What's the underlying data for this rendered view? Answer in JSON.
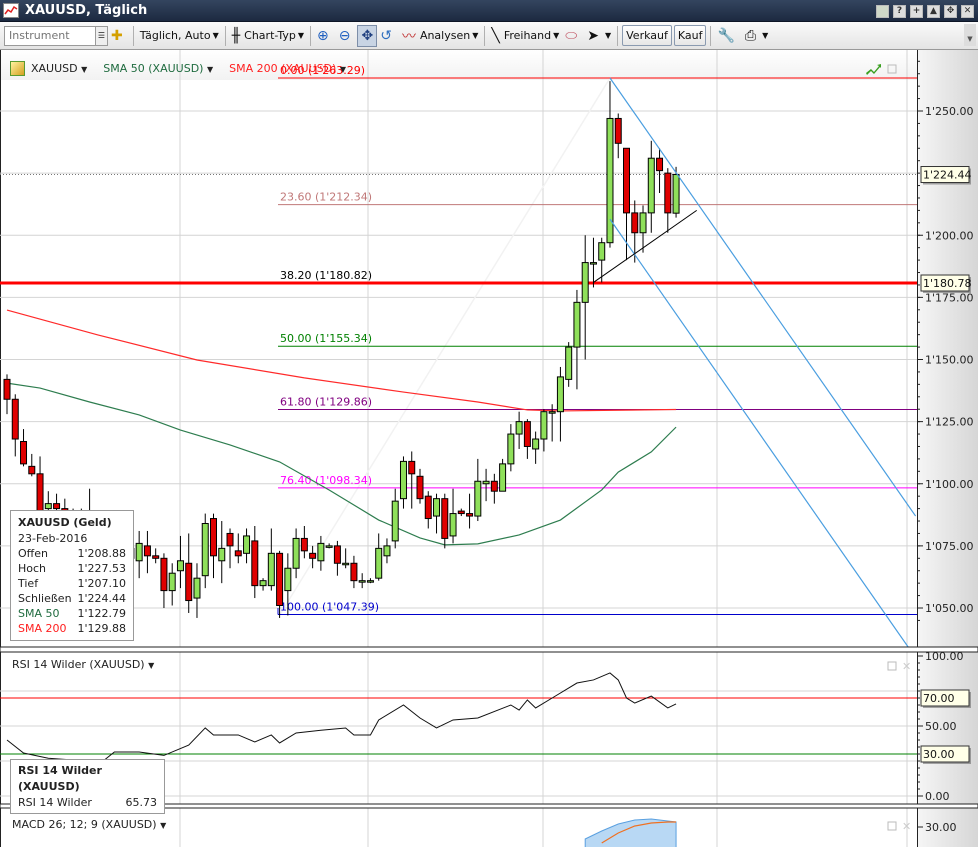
{
  "window": {
    "title": "XAUUSD, Täglich",
    "buttons": [
      "restore",
      "help",
      "new",
      "minimize",
      "maximize",
      "close"
    ]
  },
  "toolbar": {
    "instrument_placeholder": "Instrument",
    "period": "Täglich,  Auto",
    "chart_type": "Chart-Typ",
    "analysen": "Analysen",
    "freihand": "Freihand",
    "verkauf": "Verkauf",
    "kauf": "Kauf"
  },
  "legend": {
    "instrument": "XAUUSD",
    "sma50": "SMA 50 (XAUUSD)",
    "sma200": "SMA 200 (XAUUSD)",
    "caret": "▼"
  },
  "tooltip": {
    "title": "XAUUSD (Geld)",
    "date": "23-Feb-2016",
    "rows": [
      {
        "label": "Offen",
        "value": "1'208.88"
      },
      {
        "label": "Hoch",
        "value": "1'227.53"
      },
      {
        "label": "Tief",
        "value": "1'207.10"
      },
      {
        "label": "Schließen",
        "value": "1'224.44"
      },
      {
        "label": "SMA 50",
        "value": "1'122.79"
      },
      {
        "label": "SMA 200",
        "value": "1'129.88"
      }
    ]
  },
  "rsi_panel": {
    "legend": "RSI 14 Wilder (XAUUSD)",
    "tooltip_title": "RSI 14 Wilder (XAUUSD)",
    "tooltip_label": "RSI 14 Wilder",
    "tooltip_value": "65.73"
  },
  "macd_panel": {
    "legend": "MACD 26; 12; 9 (XAUUSD)"
  },
  "colors": {
    "up": "#8fe05a",
    "down": "#e00000",
    "sma50": "#2e7d4f",
    "sma200": "#ff2a2a",
    "channel": "#4a9ee0"
  },
  "chart_data": {
    "type": "candlestick",
    "symbol": "XAUUSD",
    "ohlc": [
      [
        1142,
        1144,
        1128,
        1134
      ],
      [
        1134,
        1136,
        1111,
        1118
      ],
      [
        1117,
        1122,
        1107,
        1108
      ],
      [
        1107,
        1112,
        1103,
        1104
      ],
      [
        1104,
        1111,
        1083,
        1087
      ],
      [
        1090,
        1097,
        1080,
        1092
      ],
      [
        1092,
        1096,
        1080,
        1090
      ],
      [
        1090,
        1094,
        1072,
        1080
      ],
      [
        1080,
        1090,
        1070,
        1086
      ],
      [
        1086,
        1090,
        1074,
        1082
      ],
      [
        1082,
        1098,
        1062,
        1066
      ],
      [
        1066,
        1080,
        1060,
        1069
      ],
      [
        1070,
        1076,
        1055,
        1063
      ],
      [
        1064,
        1085,
        1060,
        1078
      ],
      [
        1078,
        1085,
        1065,
        1074
      ],
      [
        1074,
        1080,
        1060,
        1070
      ],
      [
        1069,
        1081,
        1062,
        1076
      ],
      [
        1075,
        1081,
        1064,
        1071
      ],
      [
        1071,
        1074,
        1068,
        1070
      ],
      [
        1070,
        1072,
        1050,
        1057
      ],
      [
        1057,
        1068,
        1051,
        1064
      ],
      [
        1065,
        1079,
        1058,
        1069
      ],
      [
        1068,
        1080,
        1048,
        1053
      ],
      [
        1054,
        1068,
        1046,
        1062
      ],
      [
        1063,
        1088,
        1058,
        1084
      ],
      [
        1086,
        1088,
        1062,
        1071
      ],
      [
        1069,
        1085,
        1060,
        1074
      ],
      [
        1080,
        1082,
        1066,
        1075
      ],
      [
        1073,
        1080,
        1068,
        1071
      ],
      [
        1072,
        1082,
        1068,
        1079
      ],
      [
        1077,
        1083,
        1054,
        1059
      ],
      [
        1059,
        1062,
        1057,
        1061
      ],
      [
        1059,
        1082,
        1057,
        1072
      ],
      [
        1072,
        1073,
        1046,
        1051
      ],
      [
        1057,
        1072,
        1047,
        1066
      ],
      [
        1066,
        1082,
        1062,
        1078
      ],
      [
        1078,
        1083,
        1070,
        1073
      ],
      [
        1072,
        1075,
        1066,
        1070
      ],
      [
        1069,
        1079,
        1065,
        1076
      ],
      [
        1075,
        1076,
        1074,
        1075
      ],
      [
        1075,
        1077,
        1063,
        1068
      ],
      [
        1068,
        1074,
        1066,
        1068
      ],
      [
        1068,
        1071,
        1058,
        1061
      ],
      [
        1061,
        1064,
        1058,
        1061
      ],
      [
        1061,
        1062,
        1060,
        1061
      ],
      [
        1062,
        1080,
        1061,
        1074
      ],
      [
        1071,
        1078,
        1068,
        1075
      ],
      [
        1077,
        1098,
        1074,
        1093
      ],
      [
        1094,
        1111,
        1090,
        1109
      ],
      [
        1109,
        1113,
        1090,
        1104
      ],
      [
        1103,
        1106,
        1092,
        1094
      ],
      [
        1095,
        1097,
        1082,
        1086
      ],
      [
        1087,
        1096,
        1080,
        1094
      ],
      [
        1094,
        1096,
        1074,
        1078
      ],
      [
        1079,
        1098,
        1076,
        1088
      ],
      [
        1089,
        1090,
        1087,
        1088
      ],
      [
        1088,
        1096,
        1082,
        1087
      ],
      [
        1087,
        1110,
        1085,
        1101
      ],
      [
        1100,
        1106,
        1093,
        1101
      ],
      [
        1101,
        1104,
        1092,
        1097
      ],
      [
        1097,
        1110,
        1097,
        1108
      ],
      [
        1108,
        1124,
        1105,
        1120
      ],
      [
        1120,
        1129,
        1114,
        1125
      ],
      [
        1125,
        1126,
        1110,
        1115
      ],
      [
        1114,
        1121,
        1108,
        1118
      ],
      [
        1118,
        1130,
        1113,
        1129
      ],
      [
        1129,
        1132,
        1117,
        1129
      ],
      [
        1129,
        1147,
        1117,
        1143
      ],
      [
        1142,
        1157,
        1139,
        1155
      ],
      [
        1155,
        1178,
        1138,
        1173
      ],
      [
        1173,
        1200,
        1150,
        1189
      ],
      [
        1189,
        1199,
        1179,
        1189
      ],
      [
        1190,
        1199,
        1181,
        1197
      ],
      [
        1197,
        1262,
        1195,
        1247
      ],
      [
        1247,
        1249,
        1231,
        1237
      ],
      [
        1235,
        1235,
        1190,
        1209
      ],
      [
        1209,
        1214,
        1189,
        1201
      ],
      [
        1201,
        1212,
        1193,
        1209
      ],
      [
        1209,
        1238,
        1201,
        1231
      ],
      [
        1231,
        1235,
        1217,
        1226
      ],
      [
        1225,
        1227,
        1201,
        1209
      ],
      [
        1208.88,
        1227.53,
        1207.1,
        1224.44
      ]
    ],
    "sma50": [
      [
        0,
        1140.5
      ],
      [
        4,
        1138.5
      ],
      [
        10,
        1132.9
      ],
      [
        16,
        1127.7
      ],
      [
        21,
        1121.6
      ],
      [
        27,
        1115.6
      ],
      [
        33,
        1108.8
      ],
      [
        39,
        1097.5
      ],
      [
        45,
        1085.4
      ],
      [
        50,
        1078.2
      ],
      [
        53,
        1075.4
      ],
      [
        57,
        1075.8
      ],
      [
        62,
        1079.4
      ],
      [
        67,
        1085.4
      ],
      [
        72,
        1097.5
      ],
      [
        74,
        1104.7
      ],
      [
        78,
        1112.8
      ],
      [
        81,
        1122.79
      ]
    ],
    "sma200": [
      [
        0,
        1169.9
      ],
      [
        11,
        1159.9
      ],
      [
        23,
        1149.8
      ],
      [
        36,
        1142.6
      ],
      [
        48,
        1136.9
      ],
      [
        57,
        1132.9
      ],
      [
        63,
        1129.7
      ],
      [
        67,
        1129.3
      ],
      [
        81,
        1129.88
      ]
    ],
    "y_axis": {
      "ticks": [
        "1'250.00",
        "1'200.00",
        "1'175.00",
        "1'150.00",
        "1'125.00",
        "1'100.00",
        "1'075.00",
        "1'050.00"
      ],
      "tick_values": [
        1250,
        1200,
        1175,
        1150,
        1125,
        1100,
        1075,
        1050
      ],
      "range": [
        1040,
        1275
      ]
    },
    "last_price": {
      "value": 1224.44,
      "label": "1'224.44"
    },
    "hline": {
      "value": 1180.78,
      "label": "1'180.78"
    },
    "fibonacci": [
      {
        "label": "0.00 (1'263.29)",
        "value": 1263.29,
        "color": "#ff0000"
      },
      {
        "label": "23.60 (1'212.34)",
        "value": 1212.34,
        "color": "#c07878"
      },
      {
        "label": "38.20 (1'180.82)",
        "value": 1180.82,
        "color": "#000000"
      },
      {
        "label": "50.00 (1'155.34)",
        "value": 1155.34,
        "color": "#008000"
      },
      {
        "label": "61.80 (1'129.86)",
        "value": 1129.86,
        "color": "#800080"
      },
      {
        "label": "76.40 (1'098.34)",
        "value": 1098.34,
        "color": "#ff00ff"
      },
      {
        "label": "100.00 (1'047.39)",
        "value": 1047.39,
        "color": "#0000cc"
      }
    ],
    "channel": {
      "upper": [
        [
          73,
          1263.29
        ],
        [
          110,
          1087
        ]
      ],
      "lower": [
        [
          73,
          1206.5
        ],
        [
          110,
          1030
        ]
      ]
    },
    "support_trend": [
      [
        71,
        1181
      ],
      [
        83.5,
        1210
      ]
    ],
    "rsi": {
      "values": [
        [
          0,
          40
        ],
        [
          2,
          30.7
        ],
        [
          5,
          27
        ],
        [
          8,
          25.7
        ],
        [
          11,
          22
        ],
        [
          13,
          31.4
        ],
        [
          16,
          31.4
        ],
        [
          19,
          29
        ],
        [
          22,
          36.4
        ],
        [
          24,
          48.6
        ],
        [
          25,
          43.6
        ],
        [
          28,
          43.6
        ],
        [
          30,
          38.6
        ],
        [
          32,
          43.6
        ],
        [
          33,
          37.9
        ],
        [
          35,
          45
        ],
        [
          38,
          47
        ],
        [
          41,
          48.6
        ],
        [
          42,
          43.6
        ],
        [
          44,
          43.6
        ],
        [
          45,
          54.3
        ],
        [
          48,
          65
        ],
        [
          50,
          55.7
        ],
        [
          52,
          48.6
        ],
        [
          54,
          54.3
        ],
        [
          57,
          55.7
        ],
        [
          61,
          65
        ],
        [
          62,
          61.4
        ],
        [
          63,
          68.6
        ],
        [
          64,
          62.9
        ],
        [
          66,
          70
        ],
        [
          69,
          80.7
        ],
        [
          71,
          82.9
        ],
        [
          73,
          87.9
        ],
        [
          74,
          82.9
        ],
        [
          75,
          70
        ],
        [
          76,
          66.4
        ],
        [
          78,
          71.4
        ],
        [
          80,
          62.9
        ],
        [
          81,
          65.73
        ]
      ],
      "levels": [
        {
          "value": 70,
          "label": "70.00"
        },
        {
          "value": 30,
          "label": "30.00"
        }
      ],
      "ticks": [
        "100.00",
        "50.00",
        "0.00"
      ],
      "tick_values": [
        100,
        50,
        0
      ]
    },
    "macd": {
      "hist": [
        [
          70,
          18
        ],
        [
          72,
          26
        ],
        [
          74,
          33
        ],
        [
          76,
          37
        ],
        [
          78,
          38
        ],
        [
          80,
          36
        ],
        [
          81,
          35
        ]
      ],
      "signal": [
        [
          72,
          14
        ],
        [
          74,
          24
        ],
        [
          76,
          31
        ],
        [
          78,
          34
        ],
        [
          80,
          35
        ],
        [
          81,
          35
        ]
      ],
      "ticks": [
        "30.00"
      ],
      "tick_values": [
        30
      ]
    }
  }
}
